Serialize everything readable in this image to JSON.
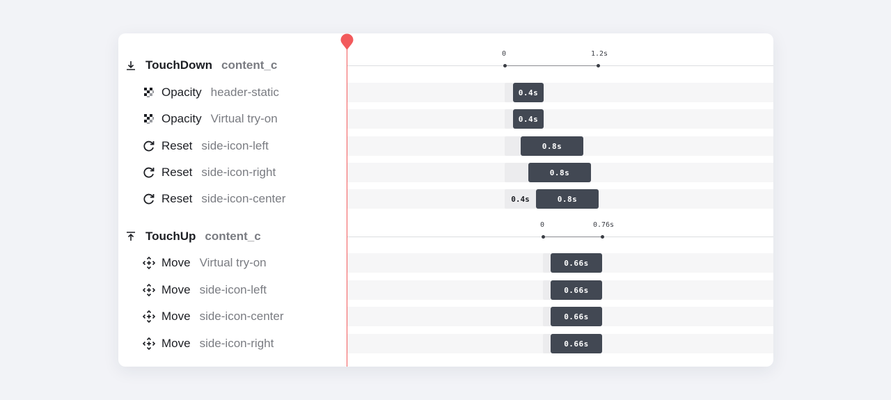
{
  "groups": [
    {
      "name": "TouchDown",
      "target": "content_c",
      "icon": "arrow-down-to-line-icon",
      "scale": {
        "start": "0",
        "end": "1.2s"
      },
      "items": [
        {
          "name": "Opacity",
          "target": "header-static",
          "icon": "checkerboard-icon",
          "delay": "",
          "duration": "0.4s"
        },
        {
          "name": "Opacity",
          "target": "Virtual try-on",
          "icon": "checkerboard-icon",
          "delay": "",
          "duration": "0.4s"
        },
        {
          "name": "Reset",
          "target": "side-icon-left",
          "icon": "rotate-icon",
          "delay": "",
          "duration": "0.8s"
        },
        {
          "name": "Reset",
          "target": "side-icon-right",
          "icon": "rotate-icon",
          "delay": "",
          "duration": "0.8s"
        },
        {
          "name": "Reset",
          "target": "side-icon-center",
          "icon": "rotate-icon",
          "delay": "0.4s",
          "duration": "0.8s"
        }
      ]
    },
    {
      "name": "TouchUp",
      "target": "content_c",
      "icon": "arrow-up-to-line-icon",
      "scale": {
        "start": "0",
        "end": "0.76s"
      },
      "items": [
        {
          "name": "Move",
          "target": "Virtual try-on",
          "icon": "move-arrows-icon",
          "delay": "",
          "duration": "0.66s"
        },
        {
          "name": "Move",
          "target": "side-icon-left",
          "icon": "move-arrows-icon",
          "delay": "",
          "duration": "0.66s"
        },
        {
          "name": "Move",
          "target": "side-icon-center",
          "icon": "move-arrows-icon",
          "delay": "",
          "duration": "0.66s"
        },
        {
          "name": "Move",
          "target": "side-icon-right",
          "icon": "move-arrows-icon",
          "delay": "",
          "duration": "0.66s"
        }
      ]
    }
  ],
  "colors": {
    "playhead": "#f25a5c",
    "bar": "#424853",
    "bar_delay": "#ececee",
    "background": "#f2f3f7"
  }
}
